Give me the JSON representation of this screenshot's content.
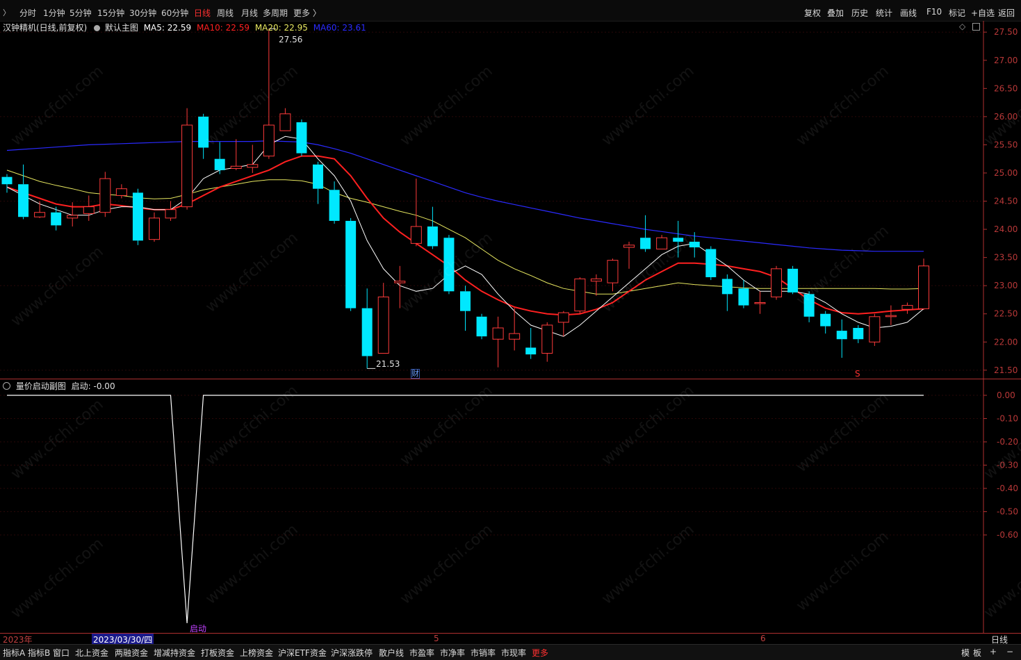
{
  "topbar": {
    "menu_icon": "gear-icon",
    "periods": [
      {
        "label": "分时",
        "active": false
      },
      {
        "label": "1分钟",
        "active": false
      },
      {
        "label": "5分钟",
        "active": false
      },
      {
        "label": "15分钟",
        "active": false
      },
      {
        "label": "30分钟",
        "active": false
      },
      {
        "label": "60分钟",
        "active": false
      },
      {
        "label": "日线",
        "active": true
      },
      {
        "label": "周线",
        "active": false
      },
      {
        "label": "月线",
        "active": false
      },
      {
        "label": "多周期",
        "active": false
      },
      {
        "label": "更多 〉",
        "active": false
      }
    ],
    "tools": [
      "复权",
      "叠加",
      "历史",
      "统计",
      "画线",
      "F10",
      "标记",
      "+自选",
      "返回"
    ]
  },
  "main": {
    "title": "汉钟精机(日线,前复权)",
    "indicator": "默认主图",
    "ma5": "MA5: 22.59",
    "ma10": "MA10: 22.59",
    "ma20": "MA20: 22.95",
    "ma60": "MA60: 23.61",
    "high_label": "27.56",
    "low_label": "21.53",
    "marker_cai": "财",
    "marker_s": "S",
    "colors": {
      "up": "#ff3b3b",
      "down": "#00e8ff",
      "ma5": "#ffffff",
      "ma10": "#ff2020",
      "ma20": "#e8e860",
      "ma60": "#2a2aff",
      "axis": "#b03030"
    },
    "y_axis_labels": [
      "27.50",
      "27.00",
      "26.50",
      "26.00",
      "25.50",
      "25.00",
      "24.50",
      "24.00",
      "23.50",
      "23.00",
      "22.50",
      "22.00",
      "21.50"
    ],
    "top_icons": [
      "diamond-icon",
      "window-icon"
    ]
  },
  "sub": {
    "title": "量价启动副图",
    "value": "启动: -0.00",
    "signal_label": "启动",
    "y_axis_labels": [
      "0.00",
      "-0.10",
      "-0.20",
      "-0.30",
      "-0.40",
      "-0.50",
      "-0.60"
    ]
  },
  "x_axis": {
    "year": "2023年",
    "cursor_date": "2023/03/30/四",
    "month_5": "5",
    "month_6": "6",
    "period_label": "日线"
  },
  "bottom_tabs": [
    "指标A",
    "指标B",
    "窗口",
    "北上资金",
    "两融资金",
    "增减持资金",
    "打板资金",
    "上榜资金",
    "沪深ETF资金",
    "沪深涨跌停",
    "散户线",
    "市盈率",
    "市净率",
    "市销率",
    "市现率",
    "更多"
  ],
  "bottom_right": {
    "mode": "模",
    "board": "板",
    "plus": "+",
    "minus": "−"
  },
  "watermark": "www.cfchi.com",
  "chart_data": {
    "type": "candlestick",
    "title": "汉钟精机(日线,前复权)",
    "ylim": [
      21.35,
      27.7
    ],
    "candles": [
      {
        "o": 24.93,
        "c": 24.8,
        "h": 24.98,
        "l": 24.65
      },
      {
        "o": 24.8,
        "c": 24.22,
        "h": 25.15,
        "l": 24.18
      },
      {
        "o": 24.22,
        "c": 24.3,
        "h": 24.5,
        "l": 24.2
      },
      {
        "o": 24.3,
        "c": 24.07,
        "h": 24.4,
        "l": 23.98
      },
      {
        "o": 24.2,
        "c": 24.25,
        "h": 24.48,
        "l": 24.05
      },
      {
        "o": 24.28,
        "c": 24.4,
        "h": 24.6,
        "l": 24.15
      },
      {
        "o": 24.3,
        "c": 24.9,
        "h": 25.02,
        "l": 24.22
      },
      {
        "o": 24.6,
        "c": 24.72,
        "h": 24.8,
        "l": 24.55
      },
      {
        "o": 24.65,
        "c": 23.8,
        "h": 24.72,
        "l": 23.72
      },
      {
        "o": 23.82,
        "c": 24.2,
        "h": 24.3,
        "l": 23.78
      },
      {
        "o": 24.2,
        "c": 24.35,
        "h": 24.5,
        "l": 24.15
      },
      {
        "o": 24.4,
        "c": 25.85,
        "h": 26.15,
        "l": 24.35
      },
      {
        "o": 26.0,
        "c": 25.45,
        "h": 26.05,
        "l": 25.25
      },
      {
        "o": 25.25,
        "c": 25.05,
        "h": 25.55,
        "l": 24.98
      },
      {
        "o": 25.08,
        "c": 25.12,
        "h": 25.6,
        "l": 25.05
      },
      {
        "o": 25.1,
        "c": 25.15,
        "h": 25.5,
        "l": 25.0
      },
      {
        "o": 25.3,
        "c": 25.85,
        "h": 27.56,
        "l": 25.25
      },
      {
        "o": 25.75,
        "c": 26.05,
        "h": 26.15,
        "l": 25.75
      },
      {
        "o": 25.9,
        "c": 25.35,
        "h": 25.95,
        "l": 25.3
      },
      {
        "o": 25.15,
        "c": 24.72,
        "h": 25.2,
        "l": 24.45
      },
      {
        "o": 24.7,
        "c": 24.15,
        "h": 24.85,
        "l": 24.1
      },
      {
        "o": 24.15,
        "c": 22.6,
        "h": 24.2,
        "l": 22.55
      },
      {
        "o": 22.6,
        "c": 21.75,
        "h": 22.95,
        "l": 21.53
      },
      {
        "o": 21.8,
        "c": 22.8,
        "h": 23.05,
        "l": 21.9
      },
      {
        "o": 23.05,
        "c": 23.08,
        "h": 23.35,
        "l": 22.6
      },
      {
        "o": 23.75,
        "c": 24.05,
        "h": 24.9,
        "l": 23.7
      },
      {
        "o": 24.05,
        "c": 23.7,
        "h": 24.4,
        "l": 23.65
      },
      {
        "o": 23.85,
        "c": 22.9,
        "h": 23.9,
        "l": 22.85
      },
      {
        "o": 22.9,
        "c": 22.55,
        "h": 23.0,
        "l": 22.2
      },
      {
        "o": 22.45,
        "c": 22.1,
        "h": 22.5,
        "l": 22.05
      },
      {
        "o": 22.05,
        "c": 22.25,
        "h": 22.45,
        "l": 21.55
      },
      {
        "o": 22.05,
        "c": 22.15,
        "h": 22.6,
        "l": 21.85
      },
      {
        "o": 21.9,
        "c": 21.78,
        "h": 22.25,
        "l": 21.7
      },
      {
        "o": 21.8,
        "c": 22.3,
        "h": 22.35,
        "l": 21.65
      },
      {
        "o": 22.35,
        "c": 22.52,
        "h": 22.55,
        "l": 22.1
      },
      {
        "o": 22.55,
        "c": 23.12,
        "h": 23.15,
        "l": 22.5
      },
      {
        "o": 23.08,
        "c": 23.12,
        "h": 23.2,
        "l": 22.82
      },
      {
        "o": 23.05,
        "c": 23.45,
        "h": 23.48,
        "l": 22.9
      },
      {
        "o": 23.68,
        "c": 23.72,
        "h": 23.78,
        "l": 23.3
      },
      {
        "o": 23.85,
        "c": 23.65,
        "h": 24.25,
        "l": 23.6
      },
      {
        "o": 23.65,
        "c": 23.85,
        "h": 23.9,
        "l": 23.65
      },
      {
        "o": 23.85,
        "c": 23.78,
        "h": 24.15,
        "l": 23.5
      },
      {
        "o": 23.78,
        "c": 23.68,
        "h": 23.95,
        "l": 23.5
      },
      {
        "o": 23.65,
        "c": 23.15,
        "h": 23.7,
        "l": 23.1
      },
      {
        "o": 23.12,
        "c": 22.85,
        "h": 23.2,
        "l": 22.55
      },
      {
        "o": 22.95,
        "c": 22.65,
        "h": 23.1,
        "l": 22.6
      },
      {
        "o": 22.7,
        "c": 22.7,
        "h": 22.9,
        "l": 22.5
      },
      {
        "o": 22.8,
        "c": 23.3,
        "h": 23.35,
        "l": 22.75
      },
      {
        "o": 23.3,
        "c": 22.88,
        "h": 23.35,
        "l": 22.85
      },
      {
        "o": 22.85,
        "c": 22.45,
        "h": 22.9,
        "l": 22.35
      },
      {
        "o": 22.5,
        "c": 22.28,
        "h": 22.55,
        "l": 22.15
      },
      {
        "o": 22.2,
        "c": 22.05,
        "h": 22.4,
        "l": 21.72
      },
      {
        "o": 22.25,
        "c": 22.05,
        "h": 22.3,
        "l": 21.98
      },
      {
        "o": 22.0,
        "c": 22.45,
        "h": 22.5,
        "l": 21.93
      },
      {
        "o": 22.45,
        "c": 22.47,
        "h": 22.65,
        "l": 22.3
      },
      {
        "o": 22.58,
        "c": 22.65,
        "h": 22.7,
        "l": 22.5
      },
      {
        "o": 22.59,
        "c": 23.35,
        "h": 23.48,
        "l": 22.57
      }
    ],
    "ma5": [
      24.75,
      24.6,
      24.45,
      24.35,
      24.25,
      24.25,
      24.35,
      24.4,
      24.4,
      24.35,
      24.35,
      24.55,
      24.9,
      25.05,
      25.1,
      25.15,
      25.5,
      25.65,
      25.6,
      25.25,
      24.95,
      24.5,
      23.8,
      23.3,
      23.0,
      22.9,
      22.95,
      23.2,
      23.35,
      23.2,
      22.85,
      22.55,
      22.3,
      22.2,
      22.1,
      22.3,
      22.55,
      22.8,
      23.05,
      23.3,
      23.55,
      23.7,
      23.75,
      23.55,
      23.35,
      23.1,
      22.9,
      22.9,
      22.9,
      22.85,
      22.7,
      22.5,
      22.35,
      22.25,
      22.28,
      22.35,
      22.59
    ],
    "ma10": [
      24.75,
      24.65,
      24.55,
      24.45,
      24.4,
      24.4,
      24.45,
      24.42,
      24.38,
      24.35,
      24.35,
      24.45,
      24.6,
      24.75,
      24.85,
      24.95,
      25.05,
      25.2,
      25.3,
      25.3,
      25.25,
      24.95,
      24.55,
      24.2,
      23.95,
      23.75,
      23.55,
      23.35,
      23.1,
      22.9,
      22.75,
      22.62,
      22.55,
      22.5,
      22.48,
      22.5,
      22.58,
      22.7,
      22.9,
      23.1,
      23.25,
      23.4,
      23.4,
      23.38,
      23.35,
      23.3,
      23.25,
      23.15,
      22.95,
      22.75,
      22.6,
      22.52,
      22.5,
      22.52,
      22.55,
      22.57,
      22.59
    ],
    "ma20": [
      25.05,
      24.95,
      24.85,
      24.78,
      24.72,
      24.65,
      24.62,
      24.6,
      24.56,
      24.54,
      24.55,
      24.62,
      24.7,
      24.75,
      24.8,
      24.85,
      24.88,
      24.88,
      24.86,
      24.8,
      24.65,
      24.55,
      24.48,
      24.4,
      24.32,
      24.25,
      24.15,
      24.0,
      23.85,
      23.65,
      23.45,
      23.3,
      23.18,
      23.05,
      22.95,
      22.9,
      22.85,
      22.85,
      22.9,
      22.95,
      23.0,
      23.05,
      23.02,
      23.0,
      22.98,
      22.96,
      22.95,
      22.95,
      22.95,
      22.95,
      22.95,
      22.95,
      22.95,
      22.95,
      22.94,
      22.94,
      22.95
    ],
    "ma60": [
      25.4,
      25.42,
      25.44,
      25.46,
      25.48,
      25.5,
      25.51,
      25.52,
      25.53,
      25.54,
      25.55,
      25.56,
      25.56,
      25.56,
      25.56,
      25.56,
      25.57,
      25.56,
      25.55,
      25.5,
      25.43,
      25.35,
      25.25,
      25.15,
      25.05,
      24.95,
      24.85,
      24.75,
      24.65,
      24.57,
      24.5,
      24.44,
      24.38,
      24.32,
      24.26,
      24.2,
      24.15,
      24.1,
      24.05,
      24.0,
      23.96,
      23.92,
      23.88,
      23.85,
      23.82,
      23.79,
      23.76,
      23.73,
      23.7,
      23.67,
      23.65,
      23.63,
      23.62,
      23.61,
      23.61,
      23.61,
      23.61
    ],
    "sub_series": {
      "name": "启动",
      "ylim": [
        -1.0,
        0.05
      ],
      "values": [
        0,
        0,
        0,
        0,
        0,
        0,
        0,
        0,
        0,
        0,
        0,
        -1.0,
        0,
        0,
        0,
        0,
        0,
        0,
        0,
        0,
        0,
        0,
        0,
        0,
        0,
        0,
        0,
        0,
        0,
        0,
        0,
        0,
        0,
        0,
        0,
        0,
        0,
        0,
        0,
        0,
        0,
        0,
        0,
        0,
        0,
        0,
        0,
        0,
        0,
        0,
        0,
        0,
        0,
        0,
        0,
        0,
        -0.0
      ]
    }
  }
}
